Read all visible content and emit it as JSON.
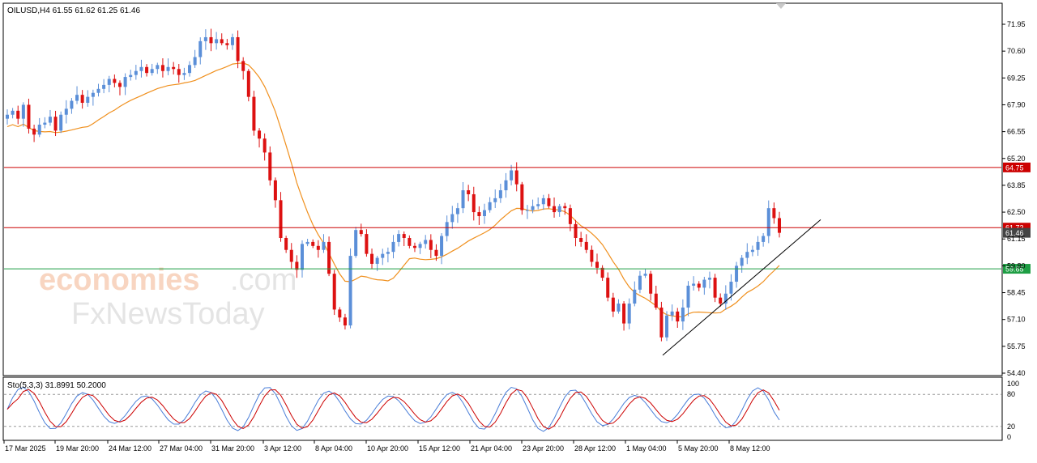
{
  "chart_data": {
    "type": "candlestick",
    "symbol_header": "OILUSD,H4  61.55 61.62 61.25 61.46",
    "ohlc_last": {
      "open": 61.55,
      "high": 61.62,
      "low": 61.25,
      "close": 61.46
    },
    "ylim": [
      54.4,
      71.95
    ],
    "y_ticks": [
      "71.95",
      "70.60",
      "69.25",
      "67.90",
      "66.55",
      "65.20",
      "63.85",
      "62.50",
      "61.15",
      "59.80",
      "58.45",
      "57.10",
      "55.75",
      "54.40"
    ],
    "x_ticks": [
      "17 Mar 2025",
      "19 Mar 20:00",
      "24 Mar 12:00",
      "27 Mar 04:00",
      "31 Mar 20:00",
      "3 Apr 12:00",
      "8 Apr 04:00",
      "10 Apr 20:00",
      "15 Apr 12:00",
      "21 Apr 04:00",
      "23 Apr 20:00",
      "28 Apr 12:00",
      "1 May 04:00",
      "5 May 20:00",
      "8 May 12:00"
    ],
    "horizontal_levels": [
      {
        "price": 64.75,
        "label": "64.75",
        "color": "#cc0000"
      },
      {
        "price": 61.72,
        "label": "61.72",
        "color": "#cc0000"
      },
      {
        "price": 61.46,
        "label": "61.46",
        "color": "#444444"
      },
      {
        "price": 59.65,
        "label": "59.65",
        "color": "#1e9e44"
      }
    ],
    "trendline": {
      "from_price": 55.3,
      "to_price": 61.5
    },
    "moving_average_color": "#f0901e",
    "bull_color": "#5b8fd8",
    "bear_color": "#dd1111",
    "price_path": [
      67.4,
      67.6,
      67.2,
      67.9,
      66.7,
      66.4,
      66.9,
      67.0,
      67.3,
      66.6,
      67.4,
      67.7,
      68.1,
      68.4,
      68.0,
      68.3,
      68.5,
      68.7,
      68.9,
      69.2,
      69.0,
      68.8,
      69.3,
      69.4,
      69.6,
      69.8,
      69.5,
      69.7,
      69.9,
      69.6,
      69.8,
      69.7,
      69.4,
      69.5,
      69.9,
      70.3,
      71.1,
      71.3,
      71.0,
      71.2,
      71.0,
      70.9,
      71.3,
      70.1,
      69.6,
      68.3,
      66.6,
      66.2,
      65.5,
      64.1,
      63.1,
      61.2,
      60.6,
      60.0,
      59.6,
      60.9,
      61.0,
      60.8,
      60.6,
      61.0,
      59.4,
      57.6,
      57.2,
      56.8,
      60.3,
      61.6,
      61.4,
      60.4,
      59.9,
      60.2,
      60.4,
      60.5,
      61.0,
      61.4,
      61.2,
      60.8,
      60.7,
      60.9,
      61.1,
      60.6,
      60.3,
      61.3,
      62.0,
      62.4,
      62.7,
      63.6,
      63.4,
      62.5,
      62.3,
      62.6,
      63.0,
      63.2,
      63.6,
      64.1,
      64.6,
      63.9,
      62.6,
      62.6,
      62.8,
      62.9,
      63.2,
      62.8,
      62.5,
      62.8,
      62.7,
      61.9,
      61.2,
      61.0,
      60.6,
      60.0,
      59.7,
      59.2,
      58.2,
      57.5,
      57.9,
      56.9,
      57.9,
      58.6,
      59.3,
      59.4,
      58.4,
      57.7,
      56.2,
      57.3,
      57.5,
      57.0,
      57.7,
      58.8,
      58.9,
      58.7,
      59.1,
      59.2,
      58.2,
      57.9,
      58.4,
      59.0,
      59.8,
      60.2,
      60.5,
      60.6,
      61.0,
      61.3,
      62.7,
      62.2,
      61.46
    ],
    "stochastic": {
      "label": "Sto(5,3,3) 31.8991 50.2000",
      "k": 31.8991,
      "d": 50.2,
      "ylim": [
        0,
        100
      ],
      "y_ticks": [
        "100",
        "80",
        "20",
        "0"
      ],
      "levels": [
        80,
        20
      ],
      "k_color": "#4a7ed8",
      "d_color": "#cc0000"
    }
  }
}
